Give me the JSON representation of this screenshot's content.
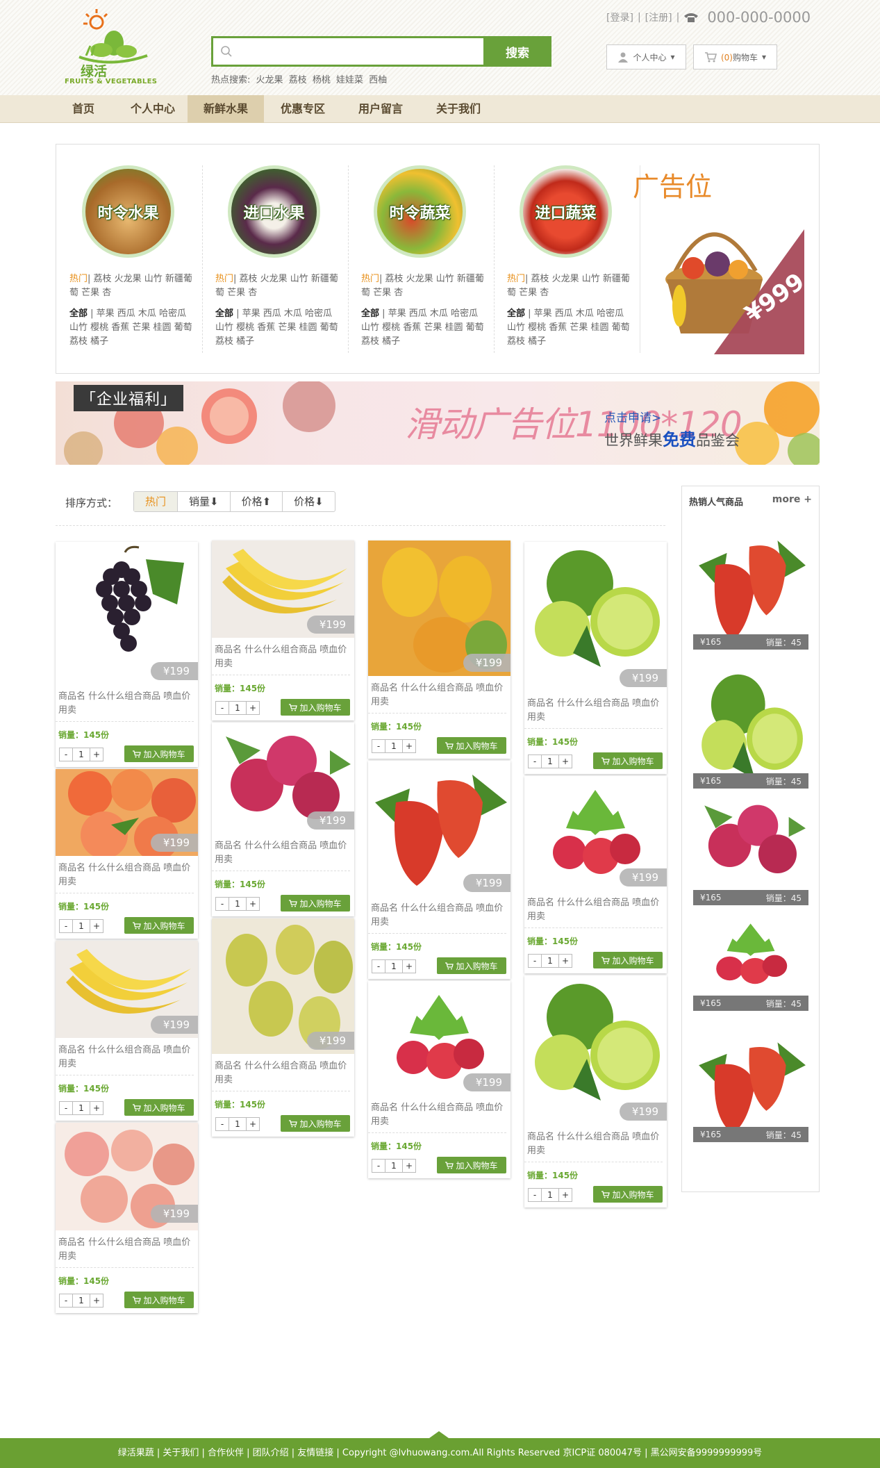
{
  "header": {
    "logo_text": "绿活",
    "logo_sub": "FRUITS & VEGETABLES",
    "search_placeholder": "",
    "search_button": "搜索",
    "hot_label": "热点搜索:",
    "hot_terms": [
      "火龙果",
      "荔枝",
      "杨桃",
      "娃娃菜",
      "西柚"
    ],
    "login": "[登录]",
    "sep": "|",
    "register": "[注册]",
    "phone": "000-000-0000",
    "user_center": "个人中心",
    "cart_count": "(0)",
    "cart_label": "购物车"
  },
  "nav": [
    "首页",
    "个人中心",
    "新鲜水果",
    "优惠专区",
    "用户留言",
    "关于我们"
  ],
  "nav_active_index": 2,
  "categories": [
    {
      "title": "时令水果",
      "hot_label": "热门",
      "hot": "荔枝 火龙果 山竹 新疆葡萄 芒果 杏",
      "all_label": "全部",
      "all": "苹果 西瓜 木瓜 哈密瓜 山竹 樱桃 香蕉 芒果 桂圆 葡萄 荔枝 橘子"
    },
    {
      "title": "进口水果",
      "hot_label": "热门",
      "hot": "荔枝 火龙果 山竹 新疆葡萄 芒果 杏",
      "all_label": "全部",
      "all": "苹果 西瓜 木瓜 哈密瓜 山竹 樱桃 香蕉 芒果 桂圆 葡萄 荔枝 橘子"
    },
    {
      "title": "时令蔬菜",
      "hot_label": "热门",
      "hot": "荔枝 火龙果 山竹 新疆葡萄 芒果 杏",
      "all_label": "全部",
      "all": "苹果 西瓜 木瓜 哈密瓜 山竹 樱桃 香蕉 芒果 桂圆 葡萄 荔枝 橘子"
    },
    {
      "title": "进口蔬菜",
      "hot_label": "热门",
      "hot": "荔枝 火龙果 山竹 新疆葡萄 芒果 杏",
      "all_label": "全部",
      "all": "苹果 西瓜 木瓜 哈密瓜 山竹 樱桃 香蕉 芒果 桂圆 葡萄 荔枝 橘子"
    }
  ],
  "ad": {
    "title": "广告位",
    "price": "¥999"
  },
  "banner": {
    "tag": "「企业福利」",
    "big": "滑动广告位1100*120",
    "link": "点击申请>",
    "sub_pre": "世界鲜果",
    "sub_bold": "免费",
    "sub_post": "品鉴会"
  },
  "sort": {
    "label": "排序方式：",
    "options": [
      "热门",
      "销量⬇",
      "价格⬆",
      "价格⬇"
    ],
    "active_index": 0
  },
  "product": {
    "name": "商品名 什么什么组合商品 喷血价用卖",
    "sales": "销量：145份",
    "price": "¥199",
    "qty": "1",
    "add_cart": "加入购物车",
    "minus": "-",
    "plus": "+"
  },
  "sidebar": {
    "title": "热销人气商品",
    "more": "more +",
    "items": [
      {
        "fruit": "strawberry",
        "price": "¥165",
        "sales": "销量：45"
      },
      {
        "fruit": "lime",
        "price": "¥165",
        "sales": "销量：45"
      },
      {
        "fruit": "raspberry",
        "price": "¥165",
        "sales": "销量：45"
      },
      {
        "fruit": "raspberry-leaf",
        "price": "¥165",
        "sales": "销量：45"
      },
      {
        "fruit": "strawberry",
        "price": "¥165",
        "sales": "销量：45"
      }
    ]
  },
  "footer": "绿活果蔬 | 关于我们 | 合作伙伴 | 团队介绍 | 友情链接 | Copyright @lvhuowang.com.All Rights Reserved 京ICP证 080047号 | 黑公网安备9999999999号"
}
